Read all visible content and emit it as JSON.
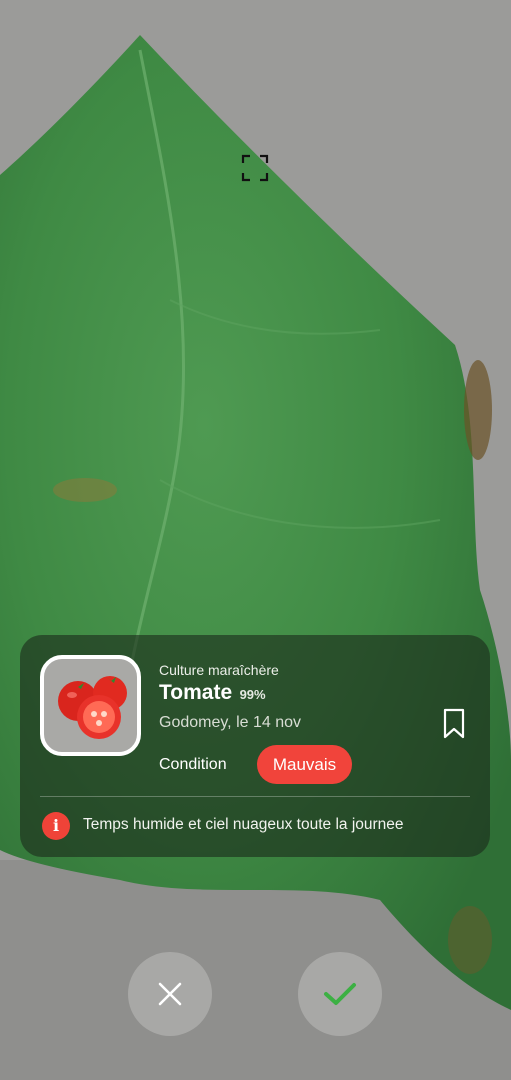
{
  "scanner": {
    "focus_icon": "focus-frame-icon"
  },
  "result": {
    "category": "Culture maraîchère",
    "title": "Tomate",
    "confidence": "99%",
    "location": "Godomey, le 14 nov",
    "bookmark_icon": "bookmark-icon",
    "condition_label": "Condition",
    "condition_value": "Mauvais",
    "condition_color": "#f1443b",
    "info_icon": "info-icon",
    "weather_note": "Temps humide et ciel nuageux toute la journee"
  },
  "actions": {
    "close_icon": "close-icon",
    "confirm_icon": "check-icon",
    "confirm_color": "#3cb043"
  }
}
